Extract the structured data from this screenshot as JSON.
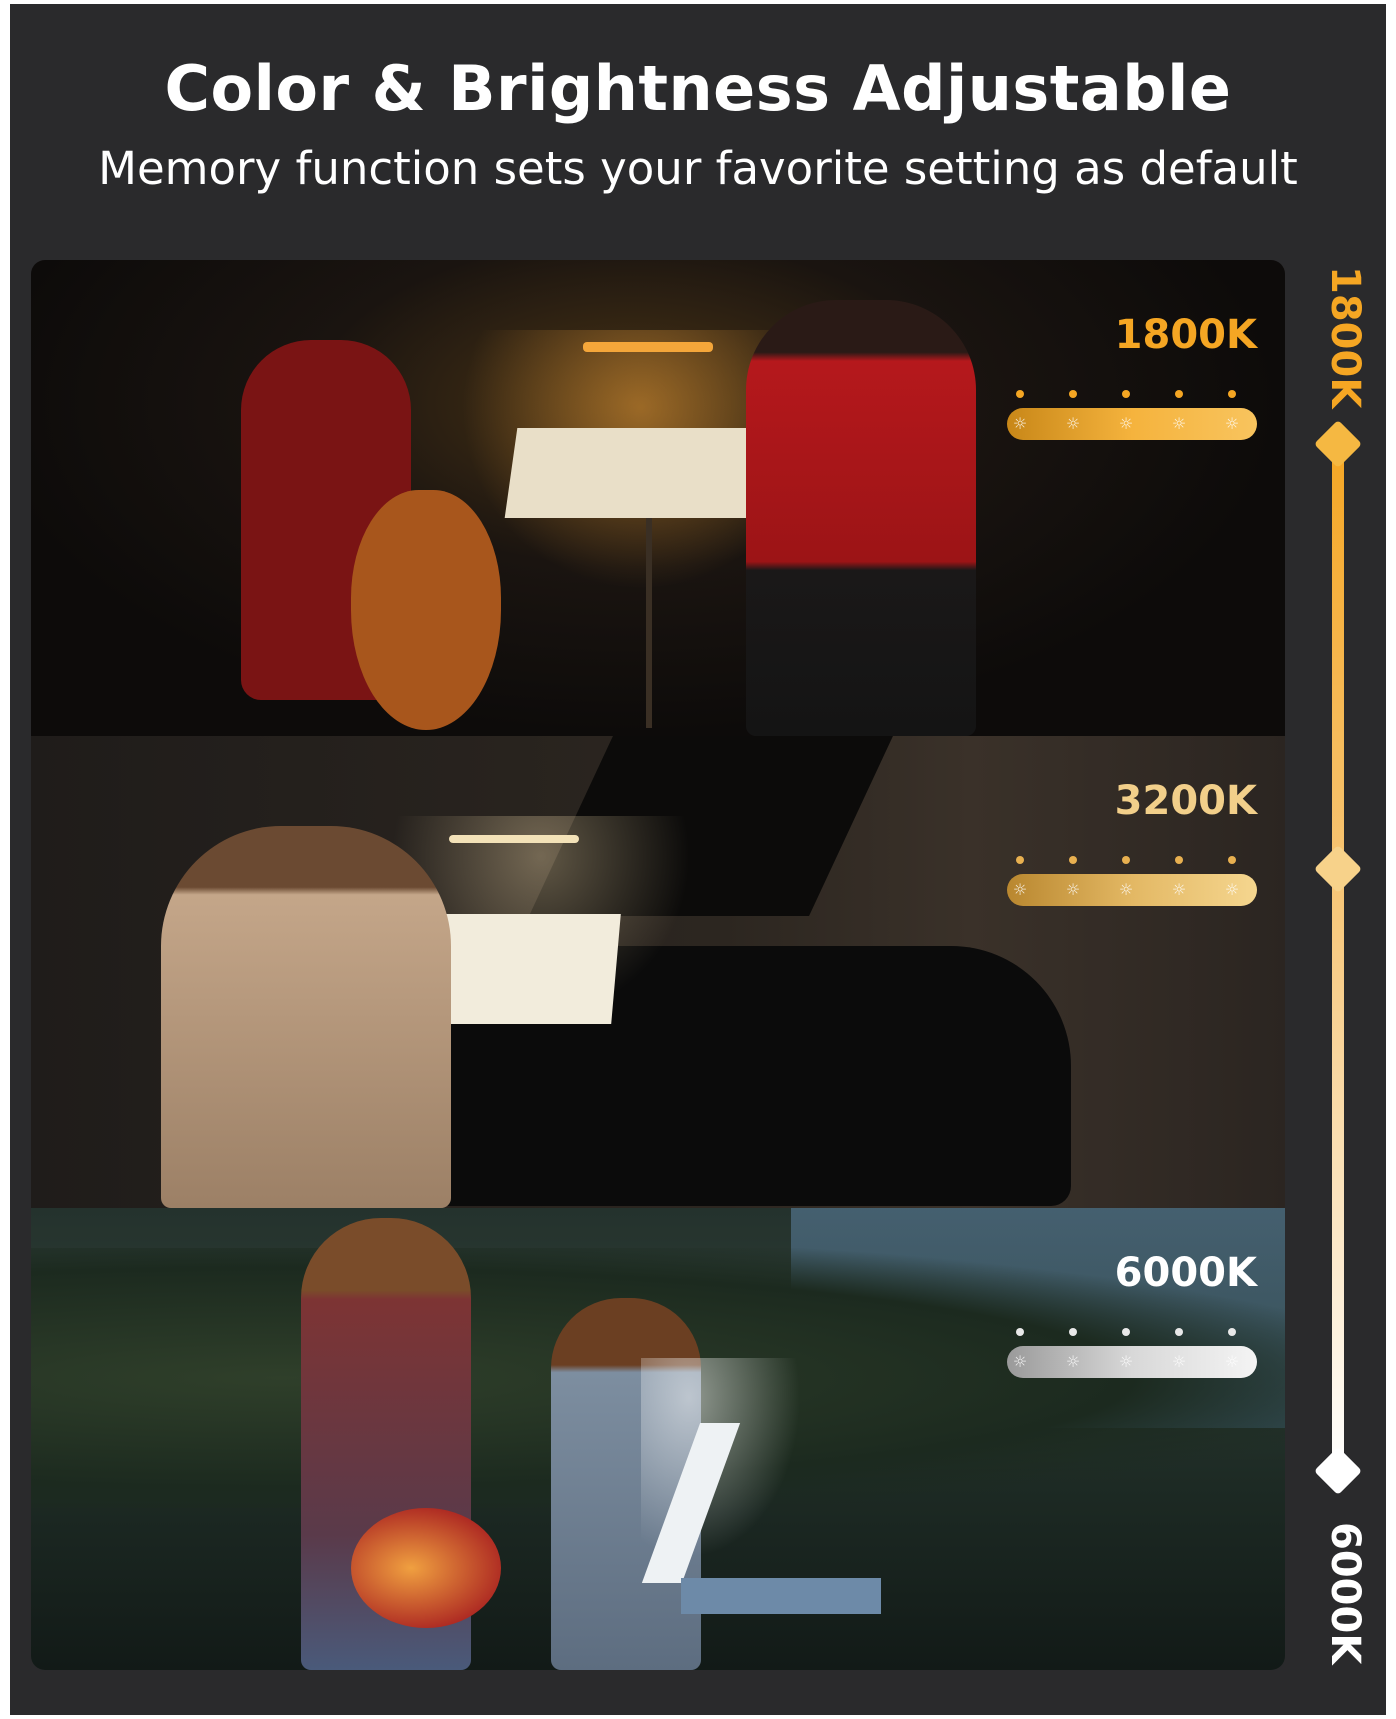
{
  "header": {
    "title": "Color & Brightness Adjustable",
    "subtitle": "Memory function sets your favorite setting as default"
  },
  "panels": [
    {
      "kelvin": "1800K",
      "color": "#f5a623"
    },
    {
      "kelvin": "3200K",
      "color": "#f2cf8a"
    },
    {
      "kelvin": "6000K",
      "color": "#ffffff"
    }
  ],
  "slider": {
    "top_label": "1800K",
    "bottom_label": "6000K"
  },
  "icons": {
    "brightness": "sun-icon"
  }
}
